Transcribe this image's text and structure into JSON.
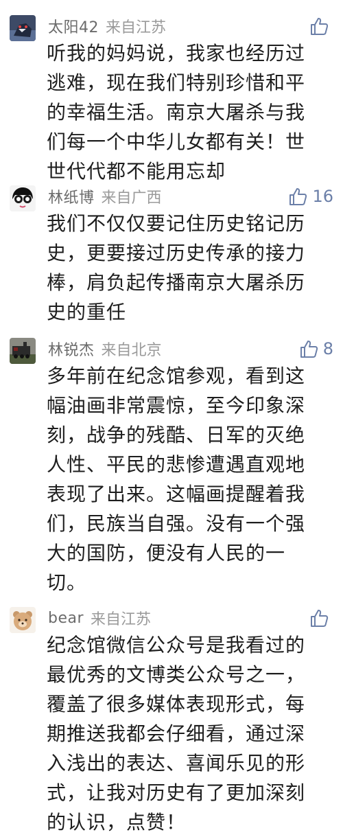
{
  "comments": [
    {
      "username": "太阳42",
      "location": "来自江苏",
      "likes": "",
      "lines": [
        "听我的妈妈说，我家也经历过",
        "逃难，现在我们特别珍惜和平",
        "的幸福生活。南京大屠杀与我",
        "们每一个中华儿女都有关！世",
        "世代代都不能用忘却"
      ]
    },
    {
      "username": "林纸博",
      "location": "来自广西",
      "likes": "16",
      "lines": [
        "我们不仅仅要记住历史铭记历",
        "史，更要接过历史传承的接力",
        "棒，肩负起传播南京大屠杀历",
        "史的重任"
      ]
    },
    {
      "username": "林锐杰",
      "location": "来自北京",
      "likes": "8",
      "lines": [
        "多年前在纪念馆参观，看到这",
        "幅油画非常震惊，至今印象深",
        "刻，战争的残酷、日军的灭绝",
        "人性、平民的悲惨遭遇直观地",
        "表现了出来。这幅画提醒着我",
        "们，民族当自强。没有一个强",
        "大的国防，便没有人民的一",
        "切。"
      ]
    },
    {
      "username": "bear",
      "location": "来自江苏",
      "likes": "",
      "lines": [
        "纪念馆微信公众号是我看过的",
        "最优秀的文博类公众号之一，",
        "覆盖了很多媒体表现形式，每",
        "期推送我都会仔细看，通过深",
        "入浅出的表达、喜闻乐见的形",
        "式，让我对历史有了更加深刻",
        "的认识，点赞！"
      ]
    }
  ],
  "icons": {
    "like": "thumbs-up-icon"
  },
  "colors": {
    "like_icon": "#6b7fa8",
    "username": "#6b6b6b",
    "location": "#9a9a9a",
    "text": "#1e1e1e"
  }
}
